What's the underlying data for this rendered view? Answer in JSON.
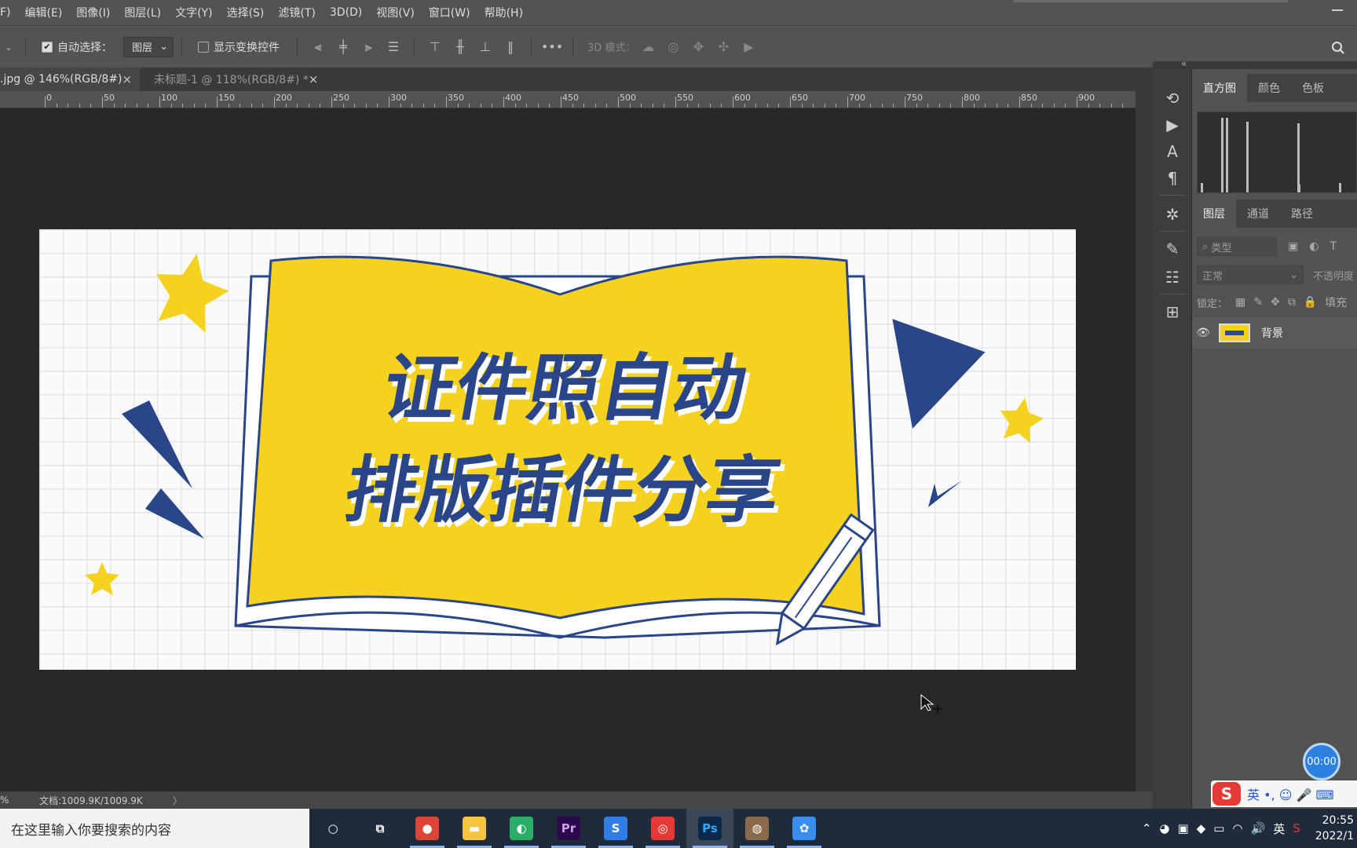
{
  "menu": [
    "F)",
    "编辑(E)",
    "图像(I)",
    "图层(L)",
    "文字(Y)",
    "选择(S)",
    "滤镜(T)",
    "3D(D)",
    "视图(V)",
    "窗口(W)",
    "帮助(H)"
  ],
  "options": {
    "auto_select_label": "自动选择：",
    "auto_select_value": "图层",
    "show_transform_label": "显示变换控件",
    "mode_3d_label": "3D 模式：",
    "more_label": "•••"
  },
  "tabs": [
    {
      "label": ".jpg @ 146%(RGB/8#)",
      "active": true
    },
    {
      "label": "未标题-1 @ 118%(RGB/8#) *",
      "active": false
    }
  ],
  "tab_close_glyph": "×",
  "ruler_labels": [
    "0",
    "50",
    "100",
    "150",
    "200",
    "250",
    "300",
    "350",
    "400",
    "450",
    "500",
    "550",
    "600",
    "650",
    "700",
    "750",
    "800",
    "850",
    "900"
  ],
  "document": {
    "title_line1": "证件照自动",
    "title_line2": "排版插件分享"
  },
  "status": {
    "zoom": "%",
    "doc_info": "文档:1009.9K/1009.9K",
    "arrow": "〉"
  },
  "panels": {
    "top_tabs": [
      "直方图",
      "颜色",
      "色板"
    ],
    "layer_tabs": [
      "图层",
      "通道",
      "路径"
    ],
    "filter_placeholder": "类型",
    "blend_mode": "正常",
    "opacity_label": "不透明度",
    "lock_label": "锁定：",
    "fill_label": "填充",
    "layer_name": "背景"
  },
  "histogram_values": [
    0.12,
    0.95,
    0.95,
    0.9,
    0.88,
    0.1,
    0.12
  ],
  "timer": "00:00",
  "ime": {
    "logo": "S",
    "text": "英 •, ☺ 🎤 ⌨"
  },
  "taskbar": {
    "search_placeholder": "在这里输入你要搜索的内容",
    "apps": [
      {
        "name": "cortana",
        "glyph": "○"
      },
      {
        "name": "task-view",
        "glyph": "⧉"
      },
      {
        "name": "chrome",
        "glyph": "●"
      },
      {
        "name": "file-explorer",
        "glyph": "▬"
      },
      {
        "name": "wechat",
        "glyph": "◐"
      },
      {
        "name": "premiere",
        "glyph": "Pr"
      },
      {
        "name": "sogou",
        "glyph": "S"
      },
      {
        "name": "netease-music",
        "glyph": "◎"
      },
      {
        "name": "photoshop",
        "glyph": "Ps"
      },
      {
        "name": "media",
        "glyph": "◍"
      },
      {
        "name": "baidu-netdisk",
        "glyph": "✿"
      }
    ],
    "tray_lang": "英",
    "time": "20:55",
    "date": "2022/1"
  },
  "colors": {
    "ps_bg": "#535353",
    "canvas": "#282828",
    "doc_yellow": "#f4d21f",
    "doc_blue": "#2a4588",
    "accent_blue": "#2d7fe0"
  }
}
